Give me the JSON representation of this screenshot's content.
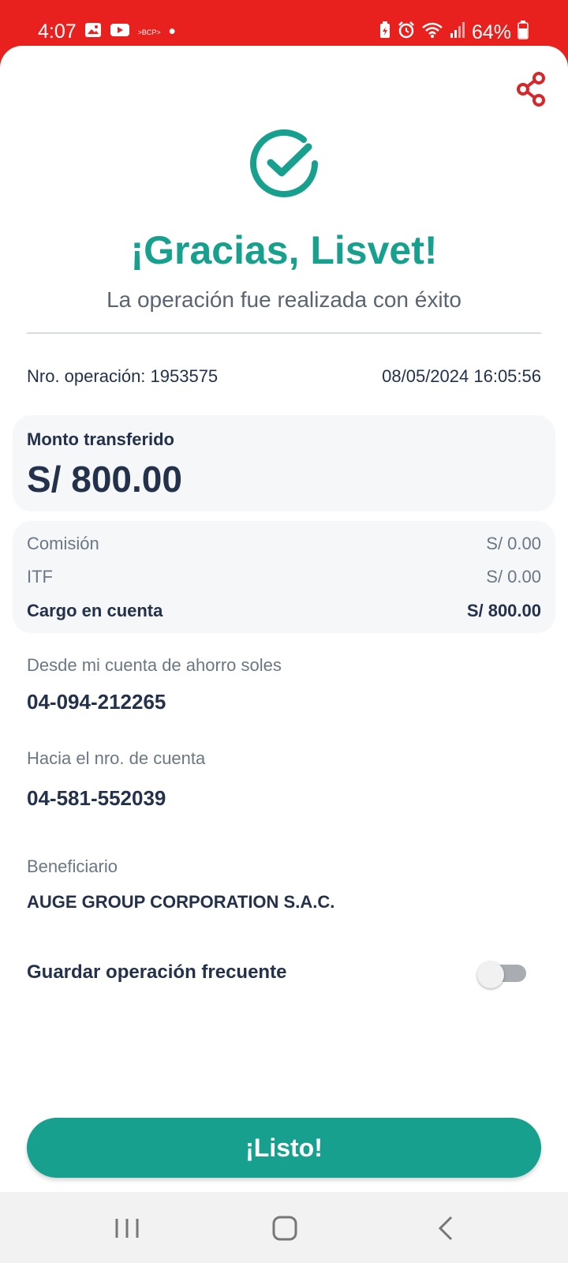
{
  "status_bar": {
    "time": "4:07",
    "bcp_badge": ">BCP>",
    "dot": "•",
    "battery_percent": "64%",
    "icons": [
      "image-icon",
      "youtube-icon",
      "battery-saver-icon",
      "alarm-icon",
      "wifi-icon",
      "signal-icon",
      "battery-icon"
    ]
  },
  "header": {
    "share_icon": "share-icon",
    "success_icon": "check-circle-icon",
    "title": "¡Gracias, Lisvet!",
    "subtitle": "La operación fue realizada con éxito"
  },
  "operation": {
    "number_text": "Nro. operación: 1953575",
    "datetime": "08/05/2024 16:05:56"
  },
  "amount": {
    "label": "Monto transferido",
    "value": "S/ 800.00"
  },
  "fees": [
    {
      "label": "Comisión",
      "value": "S/ 0.00"
    },
    {
      "label": "ITF",
      "value": "S/ 0.00"
    },
    {
      "label": "Cargo en cuenta",
      "value": "S/ 800.00"
    }
  ],
  "details": {
    "from_label": "Desde mi cuenta de ahorro soles",
    "from_value": "04-094-212265",
    "to_label": "Hacia el nro. de cuenta",
    "to_value": "04-581-552039",
    "beneficiary_label": "Beneficiario",
    "beneficiary_value": "AUGE GROUP CORPORATION S.A.C."
  },
  "save_frequent": {
    "label": "Guardar operación frecuente",
    "enabled": false
  },
  "actions": {
    "done_label": "¡Listo!"
  },
  "nav": {
    "recents_icon": "recents-icon",
    "home_icon": "home-icon",
    "back_icon": "back-icon"
  },
  "colors": {
    "accent": "#17a08e",
    "status_bar": "#e8201e",
    "text_primary": "#23324a",
    "text_secondary": "#6b7785"
  }
}
